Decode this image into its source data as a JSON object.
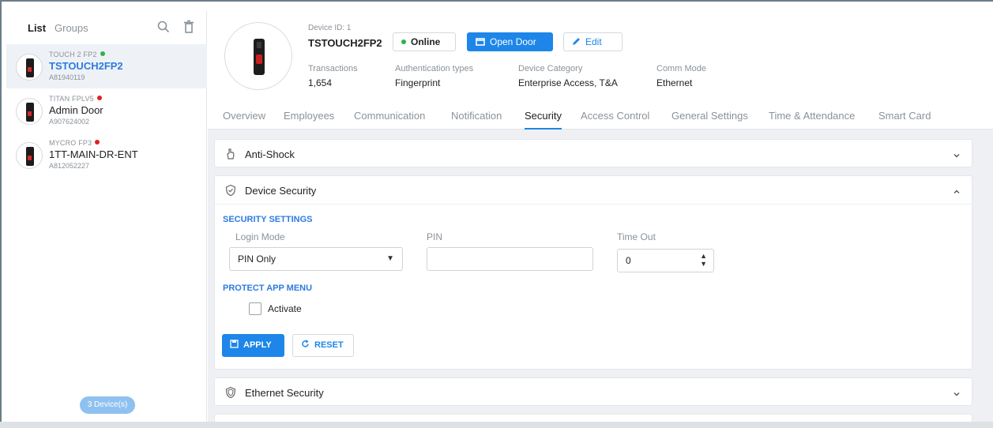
{
  "sidebar": {
    "tab_list": "List",
    "tab_groups": "Groups",
    "devices": [
      {
        "model": "TOUCH 2 FP2",
        "status": "online",
        "name": "TSTOUCH2FP2",
        "serial": "A81940119"
      },
      {
        "model": "TITAN FPLV5",
        "status": "offline",
        "name": "Admin Door",
        "serial": "A907624002"
      },
      {
        "model": "MYCRO FP3",
        "status": "offline",
        "name": "1TT-MAIN-DR-ENT",
        "serial": "A812052227"
      }
    ],
    "count_label": "3 Device(s)"
  },
  "header": {
    "device_id": "Device ID: 1",
    "device_name": "TSTOUCH2FP2",
    "online_label": "Online",
    "open_door_label": "Open Door",
    "edit_label": "Edit",
    "stats": [
      {
        "label": "Transactions",
        "value": "1,654"
      },
      {
        "label": "Authentication types",
        "value": "Fingerprint"
      },
      {
        "label": "Device Category",
        "value": "Enterprise Access, T&A"
      },
      {
        "label": "Comm Mode",
        "value": "Ethernet"
      }
    ]
  },
  "tabs": [
    "Overview",
    "Employees",
    "Communication",
    "Notification",
    "Security",
    "Access Control",
    "General Settings",
    "Time & Attendance",
    "Smart Card"
  ],
  "active_tab": "Security",
  "panels": {
    "anti_shock": {
      "title": "Anti-Shock"
    },
    "device_security": {
      "title": "Device Security",
      "security_settings_label": "SECURITY SETTINGS",
      "login_mode_label": "Login Mode",
      "login_mode_value": "PIN Only",
      "pin_label": "PIN",
      "pin_value": "",
      "timeout_label": "Time Out",
      "timeout_value": "0",
      "protect_menu_label": "PROTECT APP MENU",
      "activate_label": "Activate",
      "apply_label": "APPLY",
      "reset_label": "RESET"
    },
    "ethernet_security": {
      "title": "Ethernet Security"
    }
  },
  "colors": {
    "accent": "#1d86e8",
    "online": "#2eb04e",
    "offline": "#e02020"
  }
}
